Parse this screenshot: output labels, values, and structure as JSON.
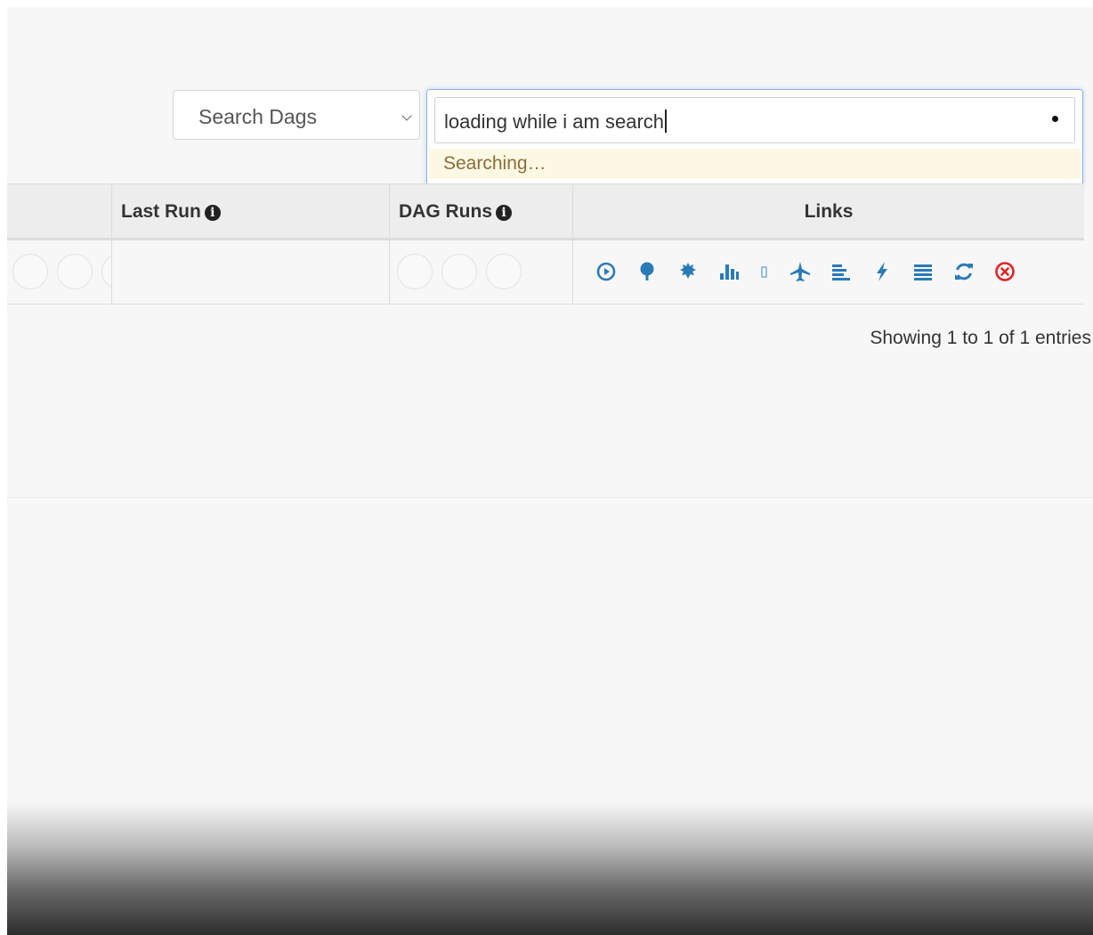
{
  "search": {
    "select_label": "Search Dags",
    "input_value": "loading while i am search",
    "status_text": "Searching…"
  },
  "table": {
    "columns": [
      {
        "label": "Last Run",
        "icon": "info-circle-icon"
      },
      {
        "label": "DAG Runs",
        "icon": "info-circle-icon"
      },
      {
        "label": "Links"
      }
    ],
    "link_icons": [
      "trigger-dag-icon",
      "tree-view-icon",
      "graph-view-icon",
      "task-duration-icon",
      "task-tries-icon",
      "landing-times-icon",
      "gantt-icon",
      "code-icon",
      "logs-icon",
      "refresh-icon",
      "delete-icon"
    ]
  },
  "pagination": {
    "info": "Showing 1 to 1 of 1 entries"
  },
  "colors": {
    "link_icon": "#2a7ab8",
    "delete_icon": "#e02424",
    "searching_bg": "#fcf8e3",
    "searching_text": "#8a6d3b"
  }
}
